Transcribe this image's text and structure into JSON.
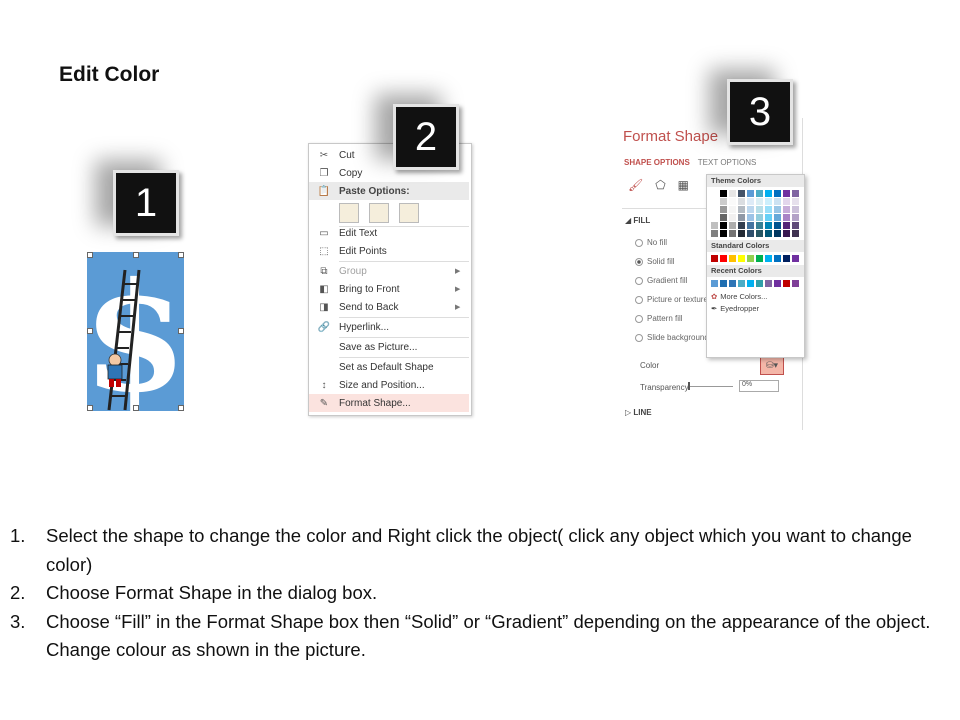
{
  "title": "Edit Color",
  "step_numbers": [
    "1",
    "2",
    "3"
  ],
  "context_menu": {
    "items": [
      {
        "label": "Cut",
        "icon": "scissors-icon"
      },
      {
        "label": "Copy",
        "icon": "copy-icon"
      },
      {
        "label": "Paste Options:",
        "icon": "paste-icon"
      },
      {
        "label": "Edit Text",
        "icon": "edit-text-icon"
      },
      {
        "label": "Edit Points",
        "icon": "edit-points-icon"
      },
      {
        "label": "Group",
        "icon": "group-icon"
      },
      {
        "label": "Bring to Front",
        "icon": "bring-front-icon"
      },
      {
        "label": "Send to Back",
        "icon": "send-back-icon"
      },
      {
        "label": "Hyperlink...",
        "icon": "hyperlink-icon"
      },
      {
        "label": "Save as Picture...",
        "icon": ""
      },
      {
        "label": "Set as Default Shape",
        "icon": ""
      },
      {
        "label": "Size and Position...",
        "icon": "size-position-icon"
      },
      {
        "label": "Format Shape...",
        "icon": "format-shape-icon"
      }
    ]
  },
  "format_pane": {
    "title": "Format Shape",
    "tab_shape": "SHAPE OPTIONS",
    "tab_text": "TEXT OPTIONS",
    "section_fill": "FILL",
    "options": [
      "No fill",
      "Solid fill",
      "Gradient fill",
      "Picture or texture fill",
      "Pattern fill",
      "Slide background fill"
    ],
    "color_label": "Color",
    "transparency_label": "Transparency",
    "transparency_value": "0%",
    "section_line": "LINE"
  },
  "palette": {
    "theme_label": "Theme Colors",
    "standard_label": "Standard Colors",
    "recent_label": "Recent Colors",
    "more_colors": "More Colors...",
    "eyedropper": "Eyedropper",
    "theme_base": [
      "#ffffff",
      "#000000",
      "#e7e6e6",
      "#44546a",
      "#5b9bd5",
      "#4bacc6",
      "#00b0f0",
      "#0070c0",
      "#7030a0",
      "#8064a2"
    ],
    "standard": [
      "#c00000",
      "#ff0000",
      "#ffc000",
      "#ffff00",
      "#92d050",
      "#00b050",
      "#00b0f0",
      "#0070c0",
      "#002060",
      "#7030a0"
    ],
    "recent": [
      "#5b9bd5",
      "#1f6fb2",
      "#2e75b6",
      "#4bacc6",
      "#00b0f0",
      "#2f9fa8",
      "#8064a2",
      "#7030a0",
      "#c00000",
      "#7f3f98"
    ]
  },
  "instructions": [
    {
      "num": "1.",
      "text": "Select the shape to change the color and Right click the object( click any object which you want to change color)"
    },
    {
      "num": "2.",
      "text": "Choose Format Shape in the dialog box."
    },
    {
      "num": "3.",
      "text": "Choose “Fill” in the Format Shape box then “Solid” or “Gradient” depending on the appearance of the object. Change colour as shown in the picture."
    }
  ]
}
